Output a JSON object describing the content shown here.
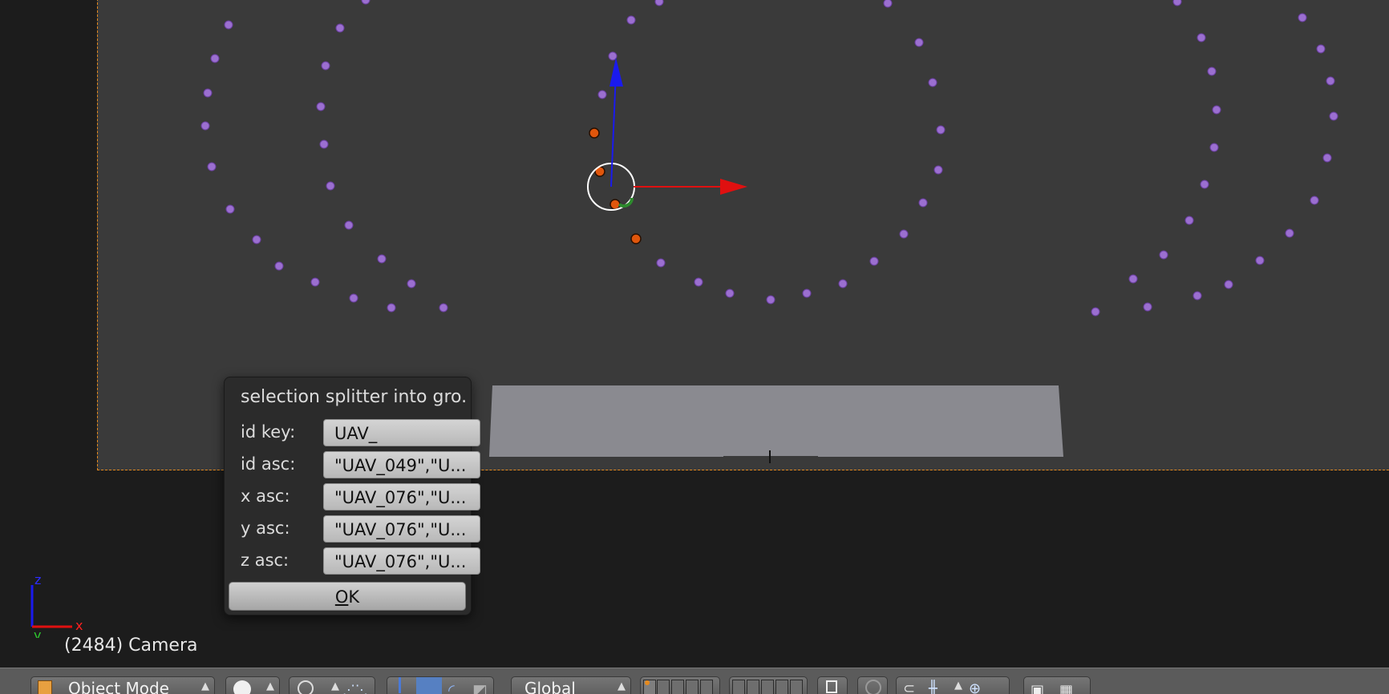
{
  "viewport": {
    "frame_info": "(2484) Camera",
    "axes": {
      "z": "z",
      "x": "x",
      "y": "y"
    }
  },
  "dialog": {
    "title": "selection splitter into gro...",
    "fields": [
      {
        "label": "id key:",
        "value": "UAV_"
      },
      {
        "label": "id asc:",
        "value": "\"UAV_049\",\"U..."
      },
      {
        "label": "x asc:",
        "value": "\"UAV_076\",\"U..."
      },
      {
        "label": "y asc:",
        "value": "\"UAV_076\",\"U..."
      },
      {
        "label": "z asc:",
        "value": "\"UAV_076\",\"U..."
      }
    ],
    "ok_label": "K",
    "ok_mnemonic": "O"
  },
  "header": {
    "mode": "Object Mode",
    "orientation": "Global"
  },
  "colors": {
    "point": "#9b6fd0",
    "selected_point": "#e0560c",
    "axis_x": "#e01010",
    "axis_z": "#1a1aee",
    "camera_border": "#e58a1e"
  }
}
